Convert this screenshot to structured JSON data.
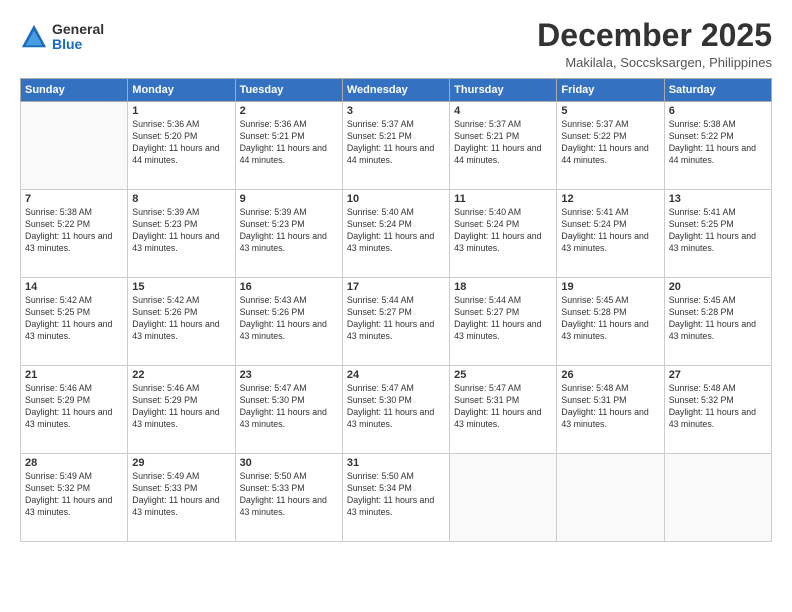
{
  "logo": {
    "general": "General",
    "blue": "Blue"
  },
  "title": "December 2025",
  "location": "Makilala, Soccsksargen, Philippines",
  "days_header": [
    "Sunday",
    "Monday",
    "Tuesday",
    "Wednesday",
    "Thursday",
    "Friday",
    "Saturday"
  ],
  "weeks": [
    [
      {
        "num": "",
        "empty": true
      },
      {
        "num": "1",
        "sunrise": "Sunrise: 5:36 AM",
        "sunset": "Sunset: 5:20 PM",
        "daylight": "Daylight: 11 hours and 44 minutes."
      },
      {
        "num": "2",
        "sunrise": "Sunrise: 5:36 AM",
        "sunset": "Sunset: 5:21 PM",
        "daylight": "Daylight: 11 hours and 44 minutes."
      },
      {
        "num": "3",
        "sunrise": "Sunrise: 5:37 AM",
        "sunset": "Sunset: 5:21 PM",
        "daylight": "Daylight: 11 hours and 44 minutes."
      },
      {
        "num": "4",
        "sunrise": "Sunrise: 5:37 AM",
        "sunset": "Sunset: 5:21 PM",
        "daylight": "Daylight: 11 hours and 44 minutes."
      },
      {
        "num": "5",
        "sunrise": "Sunrise: 5:37 AM",
        "sunset": "Sunset: 5:22 PM",
        "daylight": "Daylight: 11 hours and 44 minutes."
      },
      {
        "num": "6",
        "sunrise": "Sunrise: 5:38 AM",
        "sunset": "Sunset: 5:22 PM",
        "daylight": "Daylight: 11 hours and 44 minutes."
      }
    ],
    [
      {
        "num": "7",
        "sunrise": "Sunrise: 5:38 AM",
        "sunset": "Sunset: 5:22 PM",
        "daylight": "Daylight: 11 hours and 43 minutes."
      },
      {
        "num": "8",
        "sunrise": "Sunrise: 5:39 AM",
        "sunset": "Sunset: 5:23 PM",
        "daylight": "Daylight: 11 hours and 43 minutes."
      },
      {
        "num": "9",
        "sunrise": "Sunrise: 5:39 AM",
        "sunset": "Sunset: 5:23 PM",
        "daylight": "Daylight: 11 hours and 43 minutes."
      },
      {
        "num": "10",
        "sunrise": "Sunrise: 5:40 AM",
        "sunset": "Sunset: 5:24 PM",
        "daylight": "Daylight: 11 hours and 43 minutes."
      },
      {
        "num": "11",
        "sunrise": "Sunrise: 5:40 AM",
        "sunset": "Sunset: 5:24 PM",
        "daylight": "Daylight: 11 hours and 43 minutes."
      },
      {
        "num": "12",
        "sunrise": "Sunrise: 5:41 AM",
        "sunset": "Sunset: 5:24 PM",
        "daylight": "Daylight: 11 hours and 43 minutes."
      },
      {
        "num": "13",
        "sunrise": "Sunrise: 5:41 AM",
        "sunset": "Sunset: 5:25 PM",
        "daylight": "Daylight: 11 hours and 43 minutes."
      }
    ],
    [
      {
        "num": "14",
        "sunrise": "Sunrise: 5:42 AM",
        "sunset": "Sunset: 5:25 PM",
        "daylight": "Daylight: 11 hours and 43 minutes."
      },
      {
        "num": "15",
        "sunrise": "Sunrise: 5:42 AM",
        "sunset": "Sunset: 5:26 PM",
        "daylight": "Daylight: 11 hours and 43 minutes."
      },
      {
        "num": "16",
        "sunrise": "Sunrise: 5:43 AM",
        "sunset": "Sunset: 5:26 PM",
        "daylight": "Daylight: 11 hours and 43 minutes."
      },
      {
        "num": "17",
        "sunrise": "Sunrise: 5:44 AM",
        "sunset": "Sunset: 5:27 PM",
        "daylight": "Daylight: 11 hours and 43 minutes."
      },
      {
        "num": "18",
        "sunrise": "Sunrise: 5:44 AM",
        "sunset": "Sunset: 5:27 PM",
        "daylight": "Daylight: 11 hours and 43 minutes."
      },
      {
        "num": "19",
        "sunrise": "Sunrise: 5:45 AM",
        "sunset": "Sunset: 5:28 PM",
        "daylight": "Daylight: 11 hours and 43 minutes."
      },
      {
        "num": "20",
        "sunrise": "Sunrise: 5:45 AM",
        "sunset": "Sunset: 5:28 PM",
        "daylight": "Daylight: 11 hours and 43 minutes."
      }
    ],
    [
      {
        "num": "21",
        "sunrise": "Sunrise: 5:46 AM",
        "sunset": "Sunset: 5:29 PM",
        "daylight": "Daylight: 11 hours and 43 minutes."
      },
      {
        "num": "22",
        "sunrise": "Sunrise: 5:46 AM",
        "sunset": "Sunset: 5:29 PM",
        "daylight": "Daylight: 11 hours and 43 minutes."
      },
      {
        "num": "23",
        "sunrise": "Sunrise: 5:47 AM",
        "sunset": "Sunset: 5:30 PM",
        "daylight": "Daylight: 11 hours and 43 minutes."
      },
      {
        "num": "24",
        "sunrise": "Sunrise: 5:47 AM",
        "sunset": "Sunset: 5:30 PM",
        "daylight": "Daylight: 11 hours and 43 minutes."
      },
      {
        "num": "25",
        "sunrise": "Sunrise: 5:47 AM",
        "sunset": "Sunset: 5:31 PM",
        "daylight": "Daylight: 11 hours and 43 minutes."
      },
      {
        "num": "26",
        "sunrise": "Sunrise: 5:48 AM",
        "sunset": "Sunset: 5:31 PM",
        "daylight": "Daylight: 11 hours and 43 minutes."
      },
      {
        "num": "27",
        "sunrise": "Sunrise: 5:48 AM",
        "sunset": "Sunset: 5:32 PM",
        "daylight": "Daylight: 11 hours and 43 minutes."
      }
    ],
    [
      {
        "num": "28",
        "sunrise": "Sunrise: 5:49 AM",
        "sunset": "Sunset: 5:32 PM",
        "daylight": "Daylight: 11 hours and 43 minutes."
      },
      {
        "num": "29",
        "sunrise": "Sunrise: 5:49 AM",
        "sunset": "Sunset: 5:33 PM",
        "daylight": "Daylight: 11 hours and 43 minutes."
      },
      {
        "num": "30",
        "sunrise": "Sunrise: 5:50 AM",
        "sunset": "Sunset: 5:33 PM",
        "daylight": "Daylight: 11 hours and 43 minutes."
      },
      {
        "num": "31",
        "sunrise": "Sunrise: 5:50 AM",
        "sunset": "Sunset: 5:34 PM",
        "daylight": "Daylight: 11 hours and 43 minutes."
      },
      {
        "num": "",
        "empty": true
      },
      {
        "num": "",
        "empty": true
      },
      {
        "num": "",
        "empty": true
      }
    ]
  ]
}
